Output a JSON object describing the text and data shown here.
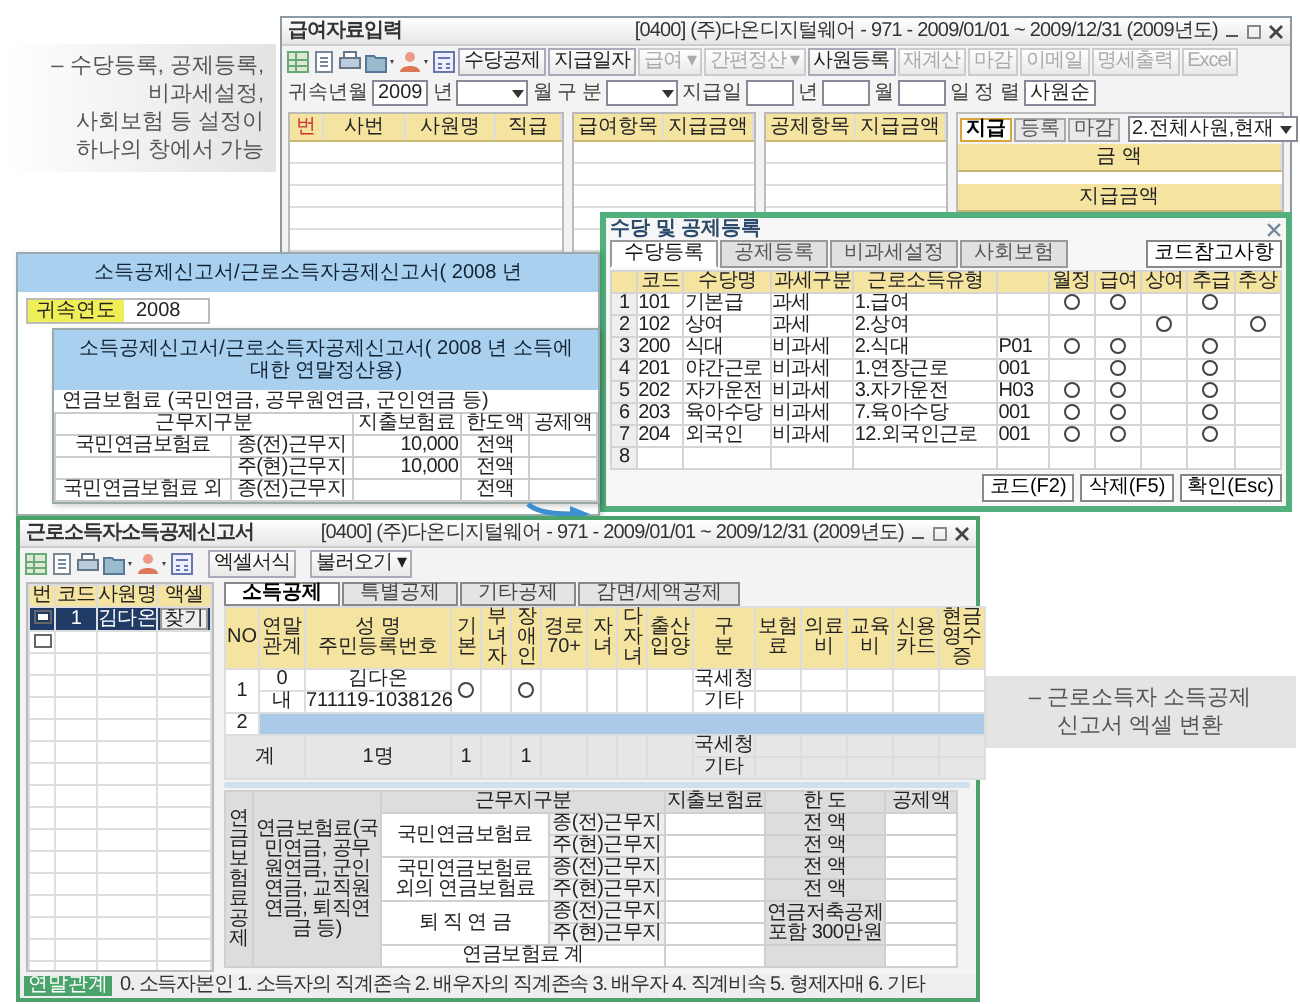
{
  "captions": [
    {
      "lines": [
        "– 수당등록, 공제등록, 비과세설정,",
        "사회보험 등 설정이 하나의 창에서 가능"
      ]
    },
    {
      "lines": [
        "– 근로소득자 소득공제",
        "신고서 엑셀 변환"
      ]
    }
  ],
  "payroll_window": {
    "title": "급여자료입력",
    "context": "[0400] (주)다온디지털웨어 - 971 - 2009/01/01 ~ 2009/12/31 (2009년도)",
    "toolbar_buttons": [
      {
        "label": "수당공제",
        "disabled": false
      },
      {
        "label": "지급일자",
        "disabled": false
      },
      {
        "label": "급여 ▾",
        "disabled": true
      },
      {
        "label": "간편정산 ▾",
        "disabled": true
      },
      {
        "label": "사원등록",
        "disabled": false
      },
      {
        "label": "재계산",
        "disabled": true
      },
      {
        "label": "마감",
        "disabled": true
      },
      {
        "label": "이메일",
        "disabled": true
      },
      {
        "label": "명세출력",
        "disabled": true
      },
      {
        "label": "Excel",
        "disabled": true
      }
    ],
    "filters": [
      {
        "kind": "label",
        "text": "귀속년월"
      },
      {
        "kind": "field",
        "value": "2009"
      },
      {
        "kind": "label",
        "text": "년"
      },
      {
        "kind": "dropdown"
      },
      {
        "kind": "label",
        "text": "월"
      },
      {
        "kind": "label",
        "text": "구 분"
      },
      {
        "kind": "dropdown"
      },
      {
        "kind": "label",
        "text": "지급일"
      },
      {
        "kind": "field"
      },
      {
        "kind": "label",
        "text": "년"
      },
      {
        "kind": "field"
      },
      {
        "kind": "label",
        "text": "월"
      },
      {
        "kind": "field"
      },
      {
        "kind": "label",
        "text": "일"
      },
      {
        "kind": "label",
        "text": "정 렬"
      },
      {
        "kind": "field",
        "value": "사원순"
      }
    ],
    "employee_columns": [
      "번",
      "사번",
      "사원명",
      "직급"
    ],
    "pay_columns": [
      "급여항목",
      "지급금액"
    ],
    "deduction_columns": [
      "공제항목",
      "지급금액"
    ],
    "side_tabs": [
      {
        "label": "지급",
        "selected": true
      },
      {
        "label": "등록",
        "selected": false
      },
      {
        "label": "마감",
        "selected": false
      }
    ],
    "side_dropdown": "2.전체사원,현재",
    "amount_header": "금 액",
    "paid_header": "지급금액"
  },
  "allowance_dialog": {
    "title": "수당 및 공제등록",
    "tabs": [
      {
        "label": "수당등록",
        "selected": true
      },
      {
        "label": "공제등록",
        "selected": false
      },
      {
        "label": "비과세설정",
        "selected": false
      },
      {
        "label": "사회보험",
        "selected": false
      }
    ],
    "note_button": "코드참고사항",
    "columns": [
      "코드",
      "수당명",
      "과세구분",
      "근로소득유형",
      "월정",
      "급여",
      "상여",
      "추급",
      "추상"
    ],
    "rows": [
      {
        "no": "1",
        "code": "101",
        "name": "기본급",
        "tax": "과세",
        "income_type": "1.급여",
        "flags": [
          true,
          true,
          false,
          true,
          false
        ]
      },
      {
        "no": "2",
        "code": "102",
        "name": "상여",
        "tax": "과세",
        "income_type": "2.상여",
        "flags": [
          false,
          false,
          true,
          false,
          true
        ]
      },
      {
        "no": "3",
        "code": "200",
        "name": "식대",
        "tax": "비과세",
        "income_type": "2.식대",
        "column_6": "P01",
        "flags": [
          true,
          true,
          false,
          true,
          false
        ]
      },
      {
        "no": "4",
        "code": "201",
        "name": "야간근로",
        "tax": "비과세",
        "income_type": "1.연장근로",
        "column_6": "001",
        "flags": [
          false,
          true,
          false,
          true,
          false
        ]
      },
      {
        "no": "5",
        "code": "202",
        "name": "자가운전",
        "tax": "비과세",
        "income_type": "3.자가운전",
        "column_6": "H03",
        "flags": [
          true,
          true,
          false,
          true,
          false
        ]
      },
      {
        "no": "6",
        "code": "203",
        "name": "육아수당",
        "tax": "비과세",
        "income_type": "7.육아수당",
        "column_6": "001",
        "flags": [
          true,
          true,
          false,
          true,
          false
        ]
      },
      {
        "no": "7",
        "code": "204",
        "name": "외국인",
        "tax": "비과세",
        "income_type": "12.외국인근로",
        "column_6": "001",
        "flags": [
          true,
          true,
          false,
          true,
          false
        ]
      },
      {
        "no": "8",
        "flags": [
          false,
          false,
          false,
          false,
          false
        ]
      }
    ],
    "buttons": [
      "코드(F2)",
      "삭제(F5)",
      "확인(Esc)"
    ]
  },
  "report_back": {
    "title": "소득공제신고서/근로소득자공제신고서( 2008 년",
    "year_label": "귀속연도",
    "year_value": "2008"
  },
  "report_front": {
    "title": "소득공제신고서/근로소득자공제신고서( 2008 년 소득에 대한 연말정산용)",
    "section": "연금보험료 (국민연금, 공무원연금, 군인연금 등)",
    "columns": [
      "근무지구분",
      "지출보험료",
      "한도액",
      "공제액"
    ],
    "rows": [
      {
        "group": "국민연금보험료",
        "workplace": "종(전)근무지",
        "amount": "10,000",
        "limit": "전액"
      },
      {
        "workplace": "주(현)근무지",
        "amount": "10,000",
        "limit": "전액"
      },
      {
        "group": "국민연금보험료 외",
        "workplace": "종(전)근무지",
        "limit": "전액"
      }
    ]
  },
  "deduction_window": {
    "title": "근로소득자소득공제신고서",
    "context": "[0400] (주)다온디지털웨어 - 971 - 2009/01/01 ~ 2009/12/31 (2009년도)",
    "toolbar_buttons": [
      "엑셀서식",
      "불러오기 ▾"
    ],
    "employee_columns": [
      "번",
      "코드",
      "사원명",
      "액셀"
    ],
    "employees": [
      {
        "checked": true,
        "code": "1",
        "name": "김다온",
        "action": "찾기",
        "selected": true
      },
      {
        "checked": false,
        "selected": false
      }
    ],
    "tabs": [
      {
        "label": "소득공제",
        "selected": true
      },
      {
        "label": "특별공제",
        "selected": false
      },
      {
        "label": "기타공제",
        "selected": false
      },
      {
        "label": "감면/세액공제",
        "selected": false
      }
    ],
    "columns": [
      {
        "label": "NO",
        "kind": "text"
      },
      {
        "label": "연말관계",
        "kind": "wide_vertical"
      },
      {
        "label": "성 명",
        "sub": "주민등록번호",
        "kind": "name"
      },
      {
        "label": "기본",
        "kind": "vertical"
      },
      {
        "label": "부녀자",
        "kind": "vertical"
      },
      {
        "label": "장애인",
        "kind": "vertical"
      },
      {
        "label": "경로",
        "sub": "70+",
        "kind": "wide_vertical"
      },
      {
        "label": "자녀",
        "kind": "vertical"
      },
      {
        "label": "다자녀",
        "kind": "vertical"
      },
      {
        "label": "출산입양",
        "kind": "wide_vertical"
      },
      {
        "label": "구분",
        "kind": "source"
      },
      {
        "label": "보험료",
        "kind": "amount"
      },
      {
        "label": "의료비",
        "kind": "amount"
      },
      {
        "label": "교육비",
        "kind": "amount"
      },
      {
        "label": "신용카드",
        "kind": "amount"
      },
      {
        "label": "현금영수증",
        "kind": "amount"
      }
    ],
    "records": [
      {
        "no": "1",
        "relation": "0",
        "nationality": "내",
        "name": "김다온",
        "id_number": "711119-1038126",
        "marks": [
          true,
          false,
          true,
          false,
          false,
          false,
          false
        ],
        "sources": [
          "국세청",
          "기타"
        ],
        "selected": false
      },
      {
        "no": "2",
        "selected": true
      }
    ],
    "total": {
      "label": "계",
      "people": "1명",
      "basic": "1",
      "disabled": "1",
      "sources": [
        "국세청",
        "기타"
      ]
    },
    "pension": {
      "section": "연금보험료공제",
      "description": "연금보험료(국민연금, 공무원연금, 군인연금, 교직원연금, 퇴직연금 등)",
      "columns": [
        "근무지구분",
        "지출보험료",
        "한 도",
        "공제액"
      ],
      "groups": [
        {
          "name": "국민연금보험료",
          "rows": [
            {
              "workplace": "종(전)근무지",
              "limit": "전 액"
            },
            {
              "workplace": "주(현)근무지",
              "limit": "전 액"
            }
          ]
        },
        {
          "name": "국민연금보험료 외의 연금보험료",
          "rows": [
            {
              "workplace": "종(전)근무지",
              "limit": "전 액"
            },
            {
              "workplace": "주(현)근무지",
              "limit": "전 액"
            }
          ]
        },
        {
          "name": "퇴 직 연 금",
          "rows": [
            {
              "workplace": "종(전)근무지"
            },
            {
              "workplace": "주(현)근무지"
            }
          ],
          "limit": "연금저축공제 포함 300만원"
        }
      ],
      "total_label": "연금보험료 계"
    },
    "status_badge": "연말관계",
    "status_text": "0. 소득자본인 1. 소득자의 직계존속 2. 배우자의 직계존속 3. 배우자 4. 직계비속 5. 형제자매 6. 기타"
  }
}
